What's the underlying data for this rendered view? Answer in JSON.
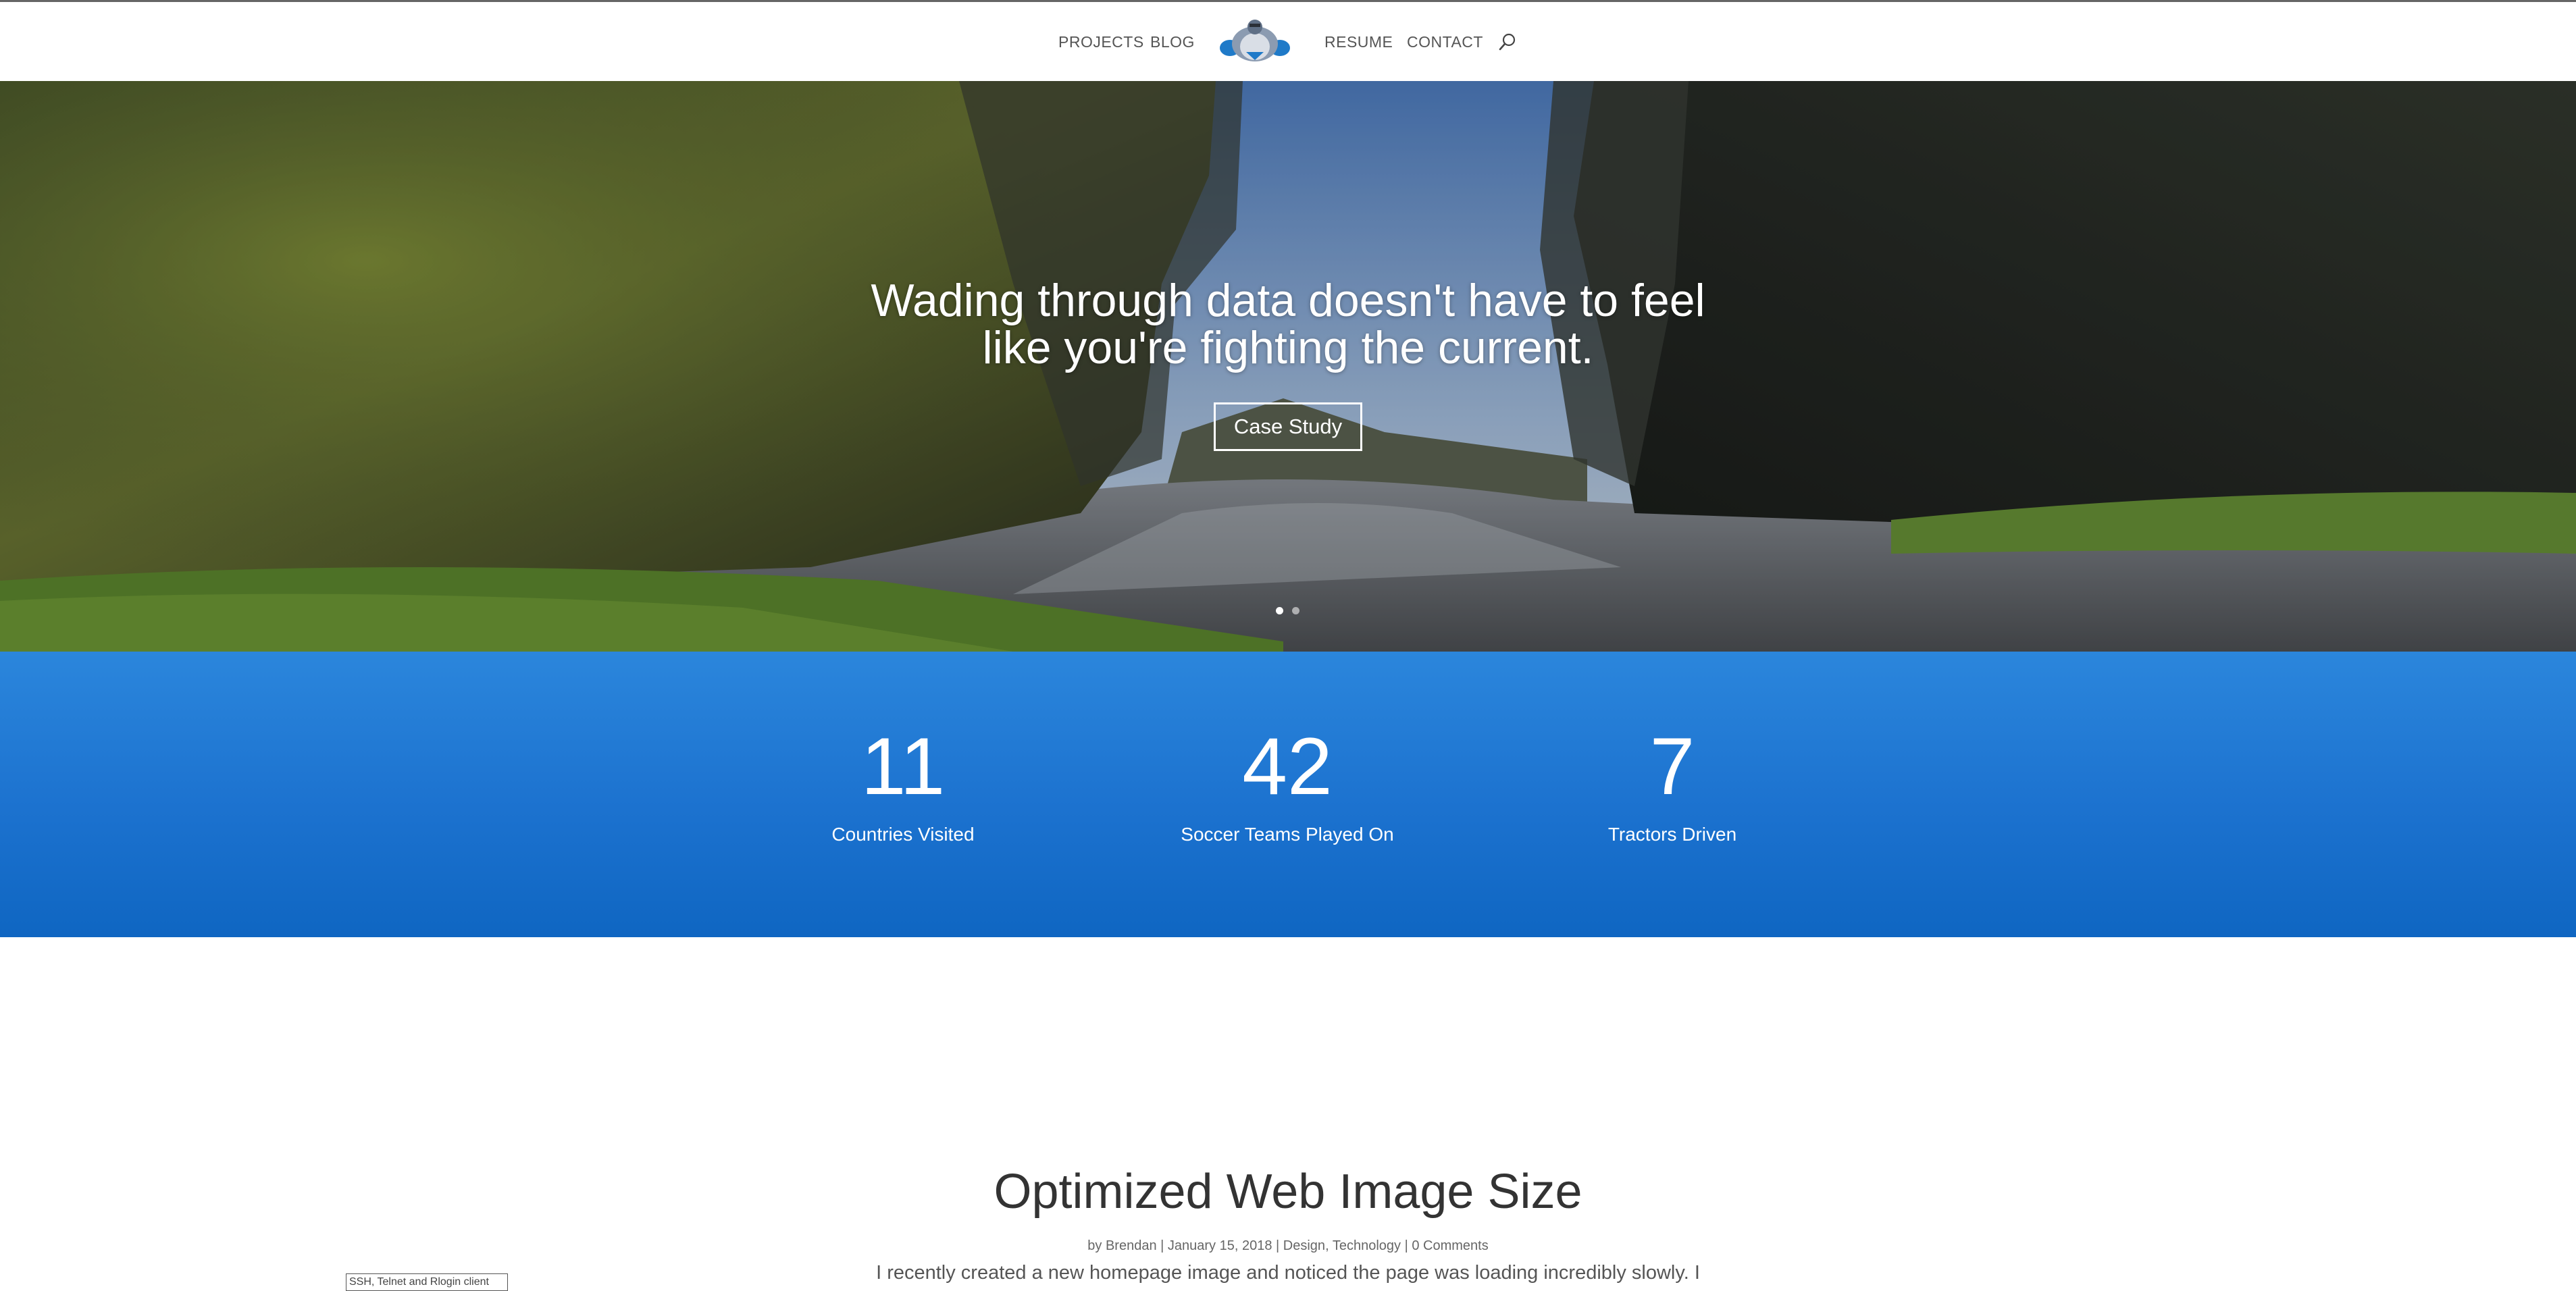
{
  "nav": {
    "projects": "PROJECTS",
    "blog": "BLOG",
    "resume": "RESUME",
    "contact": "CONTACT",
    "search_icon": "search-icon",
    "logo_icon": "gorilla-logo-icon"
  },
  "hero": {
    "headline_line1": "Wading through data doesn't have to feel",
    "headline_line2": "like you're fighting the current.",
    "cta_label": "Case Study",
    "slide_count": 2,
    "active_slide": 1
  },
  "stats": [
    {
      "number": "11",
      "label": "Countries Visited"
    },
    {
      "number": "42",
      "label": "Soccer Teams Played On"
    },
    {
      "number": "7",
      "label": "Tractors Driven"
    }
  ],
  "post": {
    "title": "Optimized Web Image Size",
    "meta": {
      "prefix": "by",
      "author": "Brendan",
      "date": "January 15, 2018",
      "categories": [
        "Design",
        "Technology"
      ],
      "comments": "0 Comments"
    },
    "excerpt": "I recently created a new homepage image and noticed the page was loading incredibly slowly. I"
  },
  "tooltip": {
    "text": "SSH, Telnet and Rlogin client"
  },
  "colors": {
    "stats_bg_top": "#2b86dc",
    "stats_bg_bottom": "#0f66c2",
    "header_bg": "#ffffff"
  }
}
